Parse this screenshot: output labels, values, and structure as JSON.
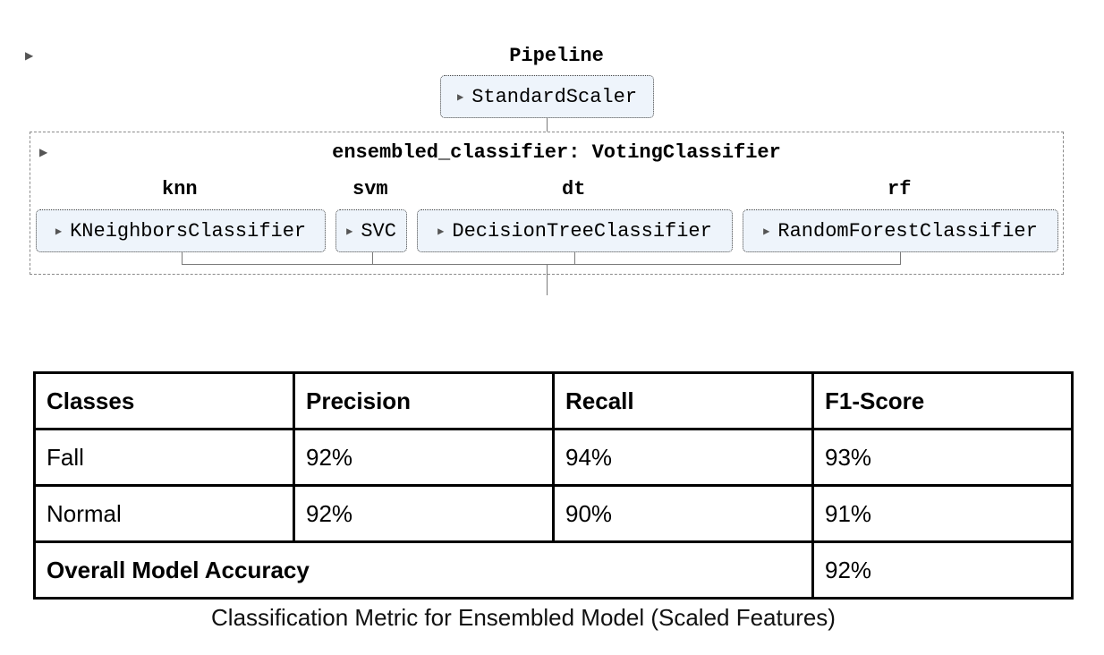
{
  "pipeline": {
    "title": "Pipeline",
    "scaler": "StandardScaler",
    "ensemble_label": "ensembled_classifier: VotingClassifier",
    "estimators": [
      {
        "name": "knn",
        "model": "KNeighborsClassifier"
      },
      {
        "name": "svm",
        "model": "SVC"
      },
      {
        "name": "dt",
        "model": "DecisionTreeClassifier"
      },
      {
        "name": "rf",
        "model": "RandomForestClassifier"
      }
    ],
    "caret_glyph": "▶"
  },
  "table": {
    "headers": [
      "Classes",
      "Precision",
      "Recall",
      "F1-Score"
    ],
    "rows": [
      [
        "Fall",
        "92%",
        "94%",
        "93%"
      ],
      [
        "Normal",
        "92%",
        "90%",
        "91%"
      ]
    ],
    "overall": {
      "label": "Overall Model Accuracy",
      "value": "92%"
    },
    "caption": "Classification Metric for Ensembled Model (Scaled Features)"
  }
}
